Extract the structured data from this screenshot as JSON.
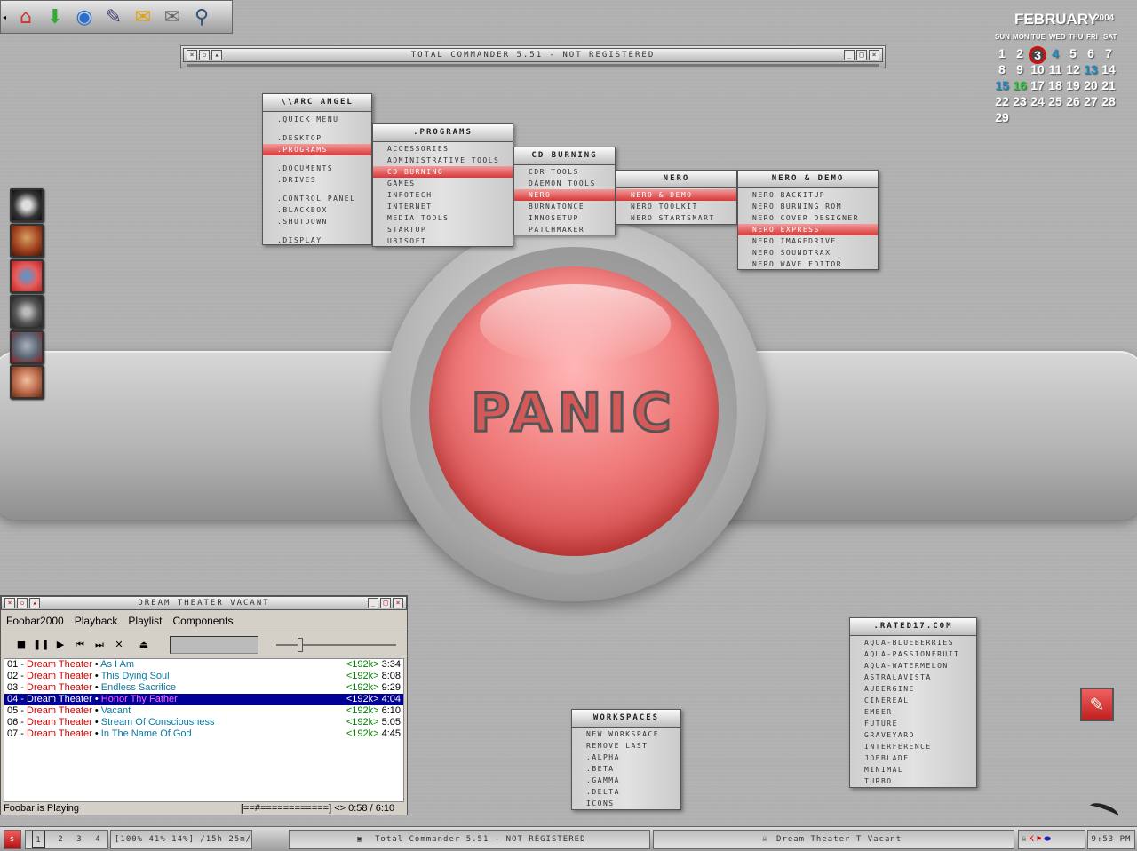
{
  "launcher": {
    "icons": [
      "home-icon",
      "download-arrow-icon",
      "globe-icon",
      "tools-icon",
      "chat-bubble-icon",
      "mail-icon",
      "magnifier-icon"
    ]
  },
  "total_commander": {
    "title": "TOTAL COMMANDER 5.51 - NOT REGISTERED"
  },
  "desktop_logo": "PANIC",
  "menus": {
    "arc_angel": {
      "title": "\\\\ARC ANGEL",
      "items": [
        ".QUICK MENU",
        "",
        ".DESKTOP",
        ".PROGRAMS",
        "",
        ".DOCUMENTS",
        ".DRIVES",
        "",
        ".CONTROL PANEL",
        ".BLACKBOX",
        ".SHUTDOWN",
        "",
        ".DISPLAY"
      ]
    },
    "programs": {
      "title": ".PROGRAMS",
      "items": [
        "ACCESSORIES",
        "ADMINISTRATIVE TOOLS",
        "CD BURNING",
        "GAMES",
        "INFOTECH",
        "INTERNET",
        "MEDIA TOOLS",
        "STARTUP",
        "UBISOFT"
      ]
    },
    "cd_burning": {
      "title": "CD BURNING",
      "items": [
        "CDR TOOLS",
        "DAEMON TOOLS",
        "NERO",
        "BURNATONCE",
        "INNOSETUP",
        "PATCHMAKER"
      ]
    },
    "nero": {
      "title": "NERO",
      "items": [
        "NERO & DEMO",
        "NERO TOOLKIT",
        "NERO STARTSMART"
      ]
    },
    "nero_demo": {
      "title": "NERO & DEMO",
      "items": [
        "NERO BACKITUP",
        "NERO BURNING ROM",
        "NERO COVER DESIGNER",
        "NERO EXPRESS",
        "NERO IMAGEDRIVE",
        "NERO SOUNDTRAX",
        "NERO WAVE EDITOR"
      ]
    },
    "workspaces": {
      "title": "WORKSPACES",
      "items": [
        "NEW WORKSPACE",
        "REMOVE LAST",
        ".ALPHA",
        ".BETA",
        ".GAMMA",
        ".DELTA",
        "ICONS"
      ]
    },
    "rated17": {
      "title": ".RATED17.COM",
      "items": [
        "AQUA-BLUEBERRIES",
        "AQUA-PASSIONFRUIT",
        "AQUA-WATERMELON",
        "ASTRALAVISTA",
        "AUBERGINE",
        "CINEREAL",
        "EMBER",
        "FUTURE",
        "GRAVEYARD",
        "INTERFERENCE",
        "JOEBLADE",
        "MINIMAL",
        "TURBO"
      ]
    }
  },
  "calendar": {
    "month": "FEBRUARY",
    "year": "2004",
    "weekdays": [
      "SUN",
      "MON",
      "TUE",
      "WED",
      "THU",
      "FRI",
      "SAT"
    ],
    "weeks": [
      [
        "1",
        "2",
        "3",
        "4",
        "5",
        "6",
        "7"
      ],
      [
        "8",
        "9",
        "10",
        "11",
        "12",
        "13",
        "14"
      ],
      [
        "15",
        "16",
        "17",
        "18",
        "19",
        "20",
        "21"
      ],
      [
        "22",
        "23",
        "24",
        "25",
        "26",
        "27",
        "28"
      ],
      [
        "29"
      ]
    ],
    "today": "3",
    "colors": {
      "today_ring": "#cc1111",
      "blue": "#1a8fc8",
      "green": "#22cc33"
    }
  },
  "foobar": {
    "title": "DREAM THEATER   VACANT",
    "menu": [
      "Foobar2000",
      "Playback",
      "Playlist",
      "Components"
    ],
    "tracks": [
      {
        "num": "01 - ",
        "artist": "Dream Theater",
        "sep": " • ",
        "title": "As I Am",
        "bitrate": "<192k>",
        "time": " 3:34"
      },
      {
        "num": "02 - ",
        "artist": "Dream Theater",
        "sep": " • ",
        "title": "This Dying Soul",
        "bitrate": "<192k>",
        "time": " 8:08"
      },
      {
        "num": "03 - ",
        "artist": "Dream Theater",
        "sep": " • ",
        "title": "Endless Sacrifice",
        "bitrate": "<192k>",
        "time": " 9:29"
      },
      {
        "num": "04 - ",
        "artist": "Dream Theater",
        "sep": " • ",
        "title": "Honor Thy Father",
        "bitrate": "<192k>",
        "time": " 4:04"
      },
      {
        "num": "05 - ",
        "artist": "Dream Theater",
        "sep": " • ",
        "title": "Vacant",
        "bitrate": "<192k>",
        "time": " 6:10"
      },
      {
        "num": "06 - ",
        "artist": "Dream Theater",
        "sep": " • ",
        "title": "Stream Of Consciousness",
        "bitrate": "<192k>",
        "time": " 5:05"
      },
      {
        "num": "07 - ",
        "artist": "Dream Theater",
        "sep": " • ",
        "title": "In The Name Of God",
        "bitrate": "<192k>",
        "time": " 4:45"
      }
    ],
    "selected_index": 3,
    "status_left": "Foobar is Playing  |",
    "status_right": "[==#============] <> 0:58 / 6:10",
    "volume": 0.1
  },
  "taskbar": {
    "workspaces": [
      "1",
      "2",
      "3",
      "4"
    ],
    "sysinfo": "[100% 41% 14%] /15h 25m/",
    "task1": "Total Commander 5.51 - NOT REGISTERED",
    "task2": "Dream Theater T Vacant",
    "clock": "9:53 PM"
  }
}
